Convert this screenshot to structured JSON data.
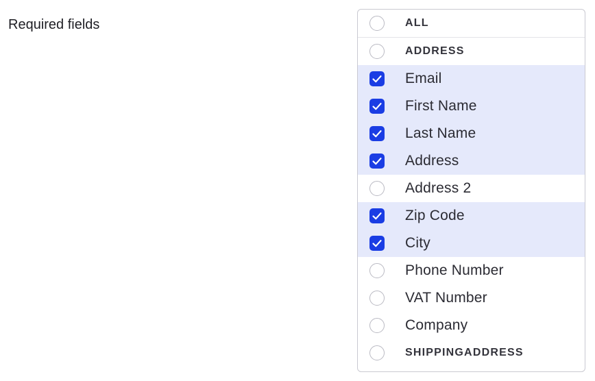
{
  "field_label": "Required fields",
  "options": [
    {
      "label": "ALL",
      "type": "group",
      "checked": false
    },
    {
      "label": "ADDRESS",
      "type": "group",
      "checked": false
    },
    {
      "label": "Email",
      "type": "item",
      "checked": true
    },
    {
      "label": "First Name",
      "type": "item",
      "checked": true
    },
    {
      "label": "Last Name",
      "type": "item",
      "checked": true
    },
    {
      "label": "Address",
      "type": "item",
      "checked": true
    },
    {
      "label": "Address 2",
      "type": "item",
      "checked": false
    },
    {
      "label": "Zip Code",
      "type": "item",
      "checked": true
    },
    {
      "label": "City",
      "type": "item",
      "checked": true
    },
    {
      "label": "Phone Number",
      "type": "item",
      "checked": false
    },
    {
      "label": "VAT Number",
      "type": "item",
      "checked": false
    },
    {
      "label": "Company",
      "type": "item",
      "checked": false
    },
    {
      "label": "SHIPPINGADDRESS",
      "type": "group",
      "checked": false
    }
  ],
  "colors": {
    "accent": "#1a3de4",
    "selected_row_bg": "#e5e9fb"
  }
}
